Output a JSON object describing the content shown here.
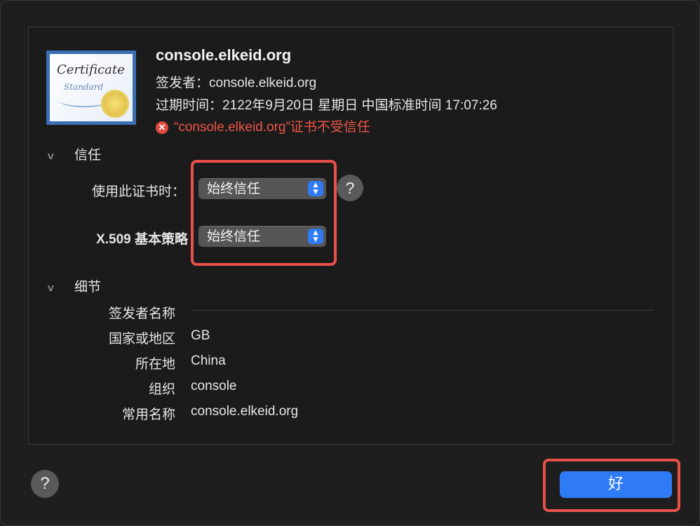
{
  "certificate": {
    "icon_name": "certificate-icon",
    "icon_text_1": "Certificate",
    "icon_text_2": "Standard",
    "title": "console.elkeid.org",
    "issuer_line": "签发者：console.elkeid.org",
    "expiry_line": "过期时间：2122年9月20日 星期日 中国标准时间 17:07:26",
    "warning": "“console.elkeid.org”证书不受信任",
    "warning_color": "#ee5546"
  },
  "trust": {
    "section_label": "信任",
    "when_using_label": "使用此证书时：",
    "when_using_value": "始终信任",
    "x509_label": "X.509 基本策略",
    "x509_value": "始终信任"
  },
  "details": {
    "section_label": "细节",
    "issuer_name_header": "签发者名称",
    "rows": [
      {
        "label": "国家或地区",
        "value": "GB"
      },
      {
        "label": "所在地",
        "value": "China"
      },
      {
        "label": "组织",
        "value": "console"
      },
      {
        "label": "常用名称",
        "value": "console.elkeid.org"
      }
    ]
  },
  "footer": {
    "help_label": "?",
    "ok_label": "好",
    "accent_color": "#2f7af5"
  },
  "highlight_color": "#e8504a"
}
